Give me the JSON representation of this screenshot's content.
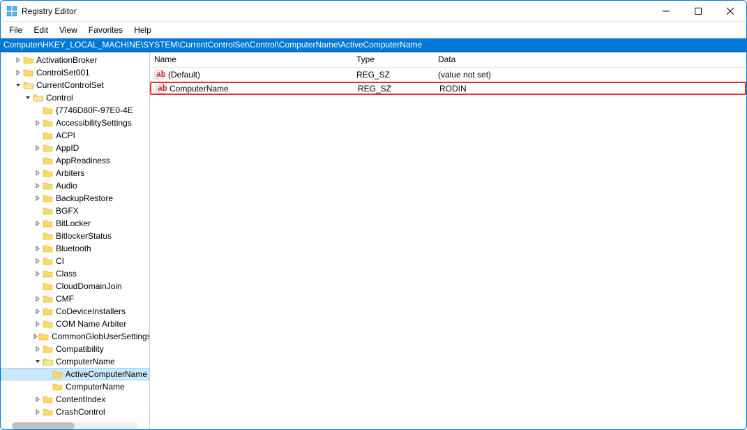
{
  "window": {
    "title": "Registry Editor"
  },
  "menu": {
    "file": "File",
    "edit": "Edit",
    "view": "View",
    "favorites": "Favorites",
    "help": "Help"
  },
  "address": "Computer\\HKEY_LOCAL_MACHINE\\SYSTEM\\CurrentControlSet\\Control\\ComputerName\\ActiveComputerName",
  "tree": {
    "items": [
      {
        "label": "ActivationBroker",
        "indent": 0,
        "expander": ">",
        "open": false
      },
      {
        "label": "ControlSet001",
        "indent": 0,
        "expander": ">",
        "open": false
      },
      {
        "label": "CurrentControlSet",
        "indent": 0,
        "expander": "v",
        "open": true
      },
      {
        "label": "Control",
        "indent": 1,
        "expander": "v",
        "open": true
      },
      {
        "label": "{7746D80F-97E0-4E",
        "indent": 2,
        "expander": "",
        "open": false
      },
      {
        "label": "AccessibilitySettings",
        "indent": 2,
        "expander": ">",
        "open": false
      },
      {
        "label": "ACPI",
        "indent": 2,
        "expander": "",
        "open": false
      },
      {
        "label": "AppID",
        "indent": 2,
        "expander": ">",
        "open": false
      },
      {
        "label": "AppReadiness",
        "indent": 2,
        "expander": "",
        "open": false
      },
      {
        "label": "Arbiters",
        "indent": 2,
        "expander": ">",
        "open": false
      },
      {
        "label": "Audio",
        "indent": 2,
        "expander": ">",
        "open": false
      },
      {
        "label": "BackupRestore",
        "indent": 2,
        "expander": ">",
        "open": false
      },
      {
        "label": "BGFX",
        "indent": 2,
        "expander": "",
        "open": false
      },
      {
        "label": "BitLocker",
        "indent": 2,
        "expander": ">",
        "open": false
      },
      {
        "label": "BitlockerStatus",
        "indent": 2,
        "expander": "",
        "open": false
      },
      {
        "label": "Bluetooth",
        "indent": 2,
        "expander": ">",
        "open": false
      },
      {
        "label": "CI",
        "indent": 2,
        "expander": ">",
        "open": false
      },
      {
        "label": "Class",
        "indent": 2,
        "expander": ">",
        "open": false
      },
      {
        "label": "CloudDomainJoin",
        "indent": 2,
        "expander": "",
        "open": false
      },
      {
        "label": "CMF",
        "indent": 2,
        "expander": ">",
        "open": false
      },
      {
        "label": "CoDeviceInstallers",
        "indent": 2,
        "expander": ">",
        "open": false
      },
      {
        "label": "COM Name Arbiter",
        "indent": 2,
        "expander": ">",
        "open": false
      },
      {
        "label": "CommonGlobUserSettings",
        "indent": 2,
        "expander": ">",
        "open": false
      },
      {
        "label": "Compatibility",
        "indent": 2,
        "expander": ">",
        "open": false
      },
      {
        "label": "ComputerName",
        "indent": 2,
        "expander": "v",
        "open": true
      },
      {
        "label": "ActiveComputerName",
        "indent": 3,
        "expander": "",
        "open": false,
        "selected": true
      },
      {
        "label": "ComputerName",
        "indent": 3,
        "expander": "",
        "open": false
      },
      {
        "label": "ContentIndex",
        "indent": 2,
        "expander": ">",
        "open": false
      },
      {
        "label": "CrashControl",
        "indent": 2,
        "expander": ">",
        "open": false
      }
    ]
  },
  "columns": {
    "name": "Name",
    "type": "Type",
    "data": "Data"
  },
  "rows": [
    {
      "name": "(Default)",
      "type": "REG_SZ",
      "data": "(value not set)",
      "highlighted": false
    },
    {
      "name": "ComputerName",
      "type": "REG_SZ",
      "data": "RODIN",
      "highlighted": true
    }
  ]
}
